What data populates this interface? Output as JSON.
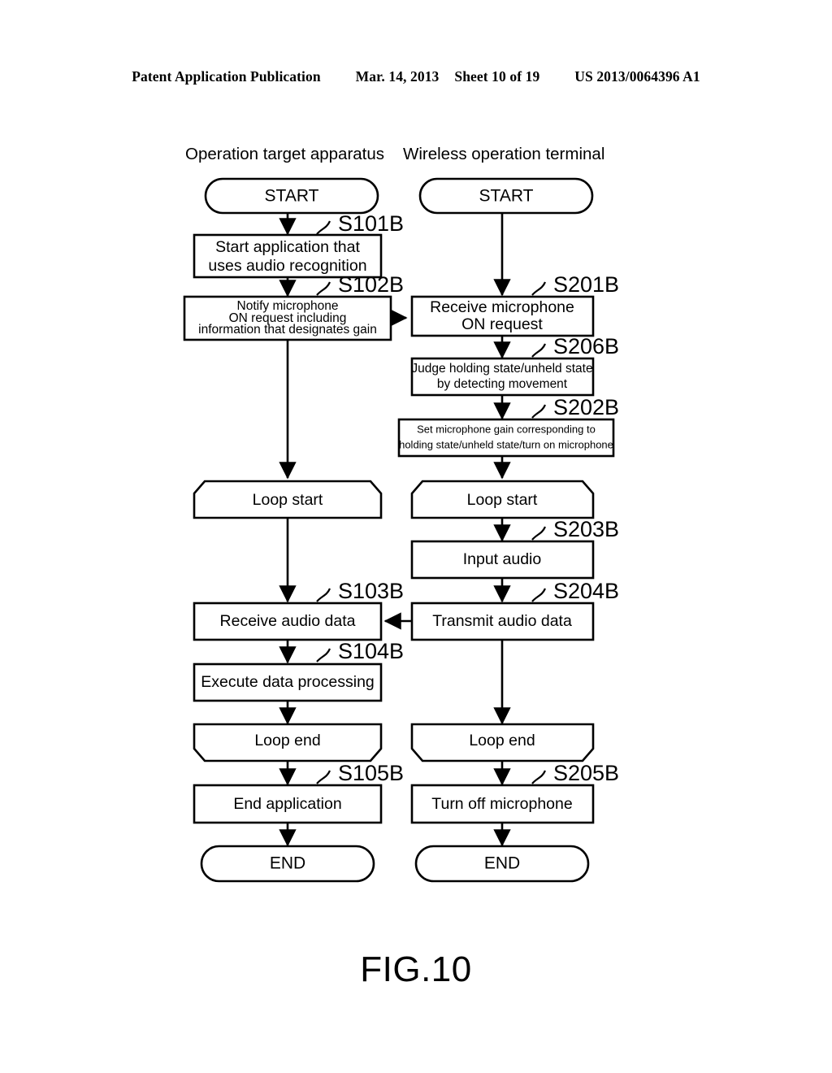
{
  "header": {
    "publication": "Patent Application Publication",
    "date": "Mar. 14, 2013",
    "sheet": "Sheet 10 of 19",
    "patent_number": "US 2013/0064396 A1"
  },
  "figure": {
    "caption": "FIG.10",
    "type": "flowchart",
    "columns": [
      {
        "id": "left",
        "title": "Operation target apparatus"
      },
      {
        "id": "right",
        "title": "Wireless operation terminal"
      }
    ]
  },
  "left_column": {
    "start": "START",
    "end": "END",
    "steps": [
      {
        "label": "S101B",
        "lines": [
          "Start application that",
          "uses audio recognition"
        ]
      },
      {
        "label": "S102B",
        "lines": [
          "Notify microphone",
          "ON request including",
          "information that designates gain"
        ]
      },
      {
        "label": "",
        "lines": [
          "Loop start"
        ]
      },
      {
        "label": "S103B",
        "lines": [
          "Receive audio data"
        ]
      },
      {
        "label": "S104B",
        "lines": [
          "Execute data processing"
        ]
      },
      {
        "label": "",
        "lines": [
          "Loop end"
        ]
      },
      {
        "label": "S105B",
        "lines": [
          "End application"
        ]
      }
    ]
  },
  "right_column": {
    "start": "START",
    "end": "END",
    "steps": [
      {
        "label": "S201B",
        "lines": [
          "Receive microphone",
          "ON request"
        ]
      },
      {
        "label": "S206B",
        "lines": [
          "Judge holding state/unheld state",
          "by detecting movement"
        ]
      },
      {
        "label": "S202B",
        "lines": [
          "Set microphone gain corresponding to",
          "holding state/unheld state/turn on microphone"
        ]
      },
      {
        "label": "",
        "lines": [
          "Loop start"
        ]
      },
      {
        "label": "S203B",
        "lines": [
          "Input audio"
        ]
      },
      {
        "label": "S204B",
        "lines": [
          "Transmit audio data"
        ]
      },
      {
        "label": "",
        "lines": [
          "Loop end"
        ]
      },
      {
        "label": "S205B",
        "lines": [
          "Turn off microphone"
        ]
      }
    ]
  },
  "nodes": {
    "l_start": "START",
    "l_s101b_1": "Start application that",
    "l_s101b_2": "uses audio recognition",
    "l_s102b_1": "Notify microphone",
    "l_s102b_2": "ON request including",
    "l_s102b_3": "information that designates gain",
    "l_loopstart": "Loop start",
    "l_s103b": "Receive audio data",
    "l_s104b": "Execute data processing",
    "l_loopend": "Loop end",
    "l_s105b": "End application",
    "l_end": "END",
    "r_start": "START",
    "r_s201b_1": "Receive microphone",
    "r_s201b_2": "ON request",
    "r_s206b_1": "Judge holding state/unheld state",
    "r_s206b_2": "by detecting movement",
    "r_s202b_1": "Set microphone gain corresponding to",
    "r_s202b_2": "holding state/unheld state/turn on microphone",
    "r_loopstart": "Loop start",
    "r_s203b": "Input audio",
    "r_s204b": "Transmit audio data",
    "r_loopend": "Loop end",
    "r_s205b": "Turn off microphone",
    "r_end": "END"
  },
  "step_labels": {
    "s101b": "S101B",
    "s102b": "S102B",
    "s103b": "S103B",
    "s104b": "S104B",
    "s105b": "S105B",
    "s201b": "S201B",
    "s202b": "S202B",
    "s203b": "S203B",
    "s204b": "S204B",
    "s205b": "S205B",
    "s206b": "S206B"
  },
  "colors": {
    "ink": "#000000",
    "paper": "#ffffff"
  }
}
